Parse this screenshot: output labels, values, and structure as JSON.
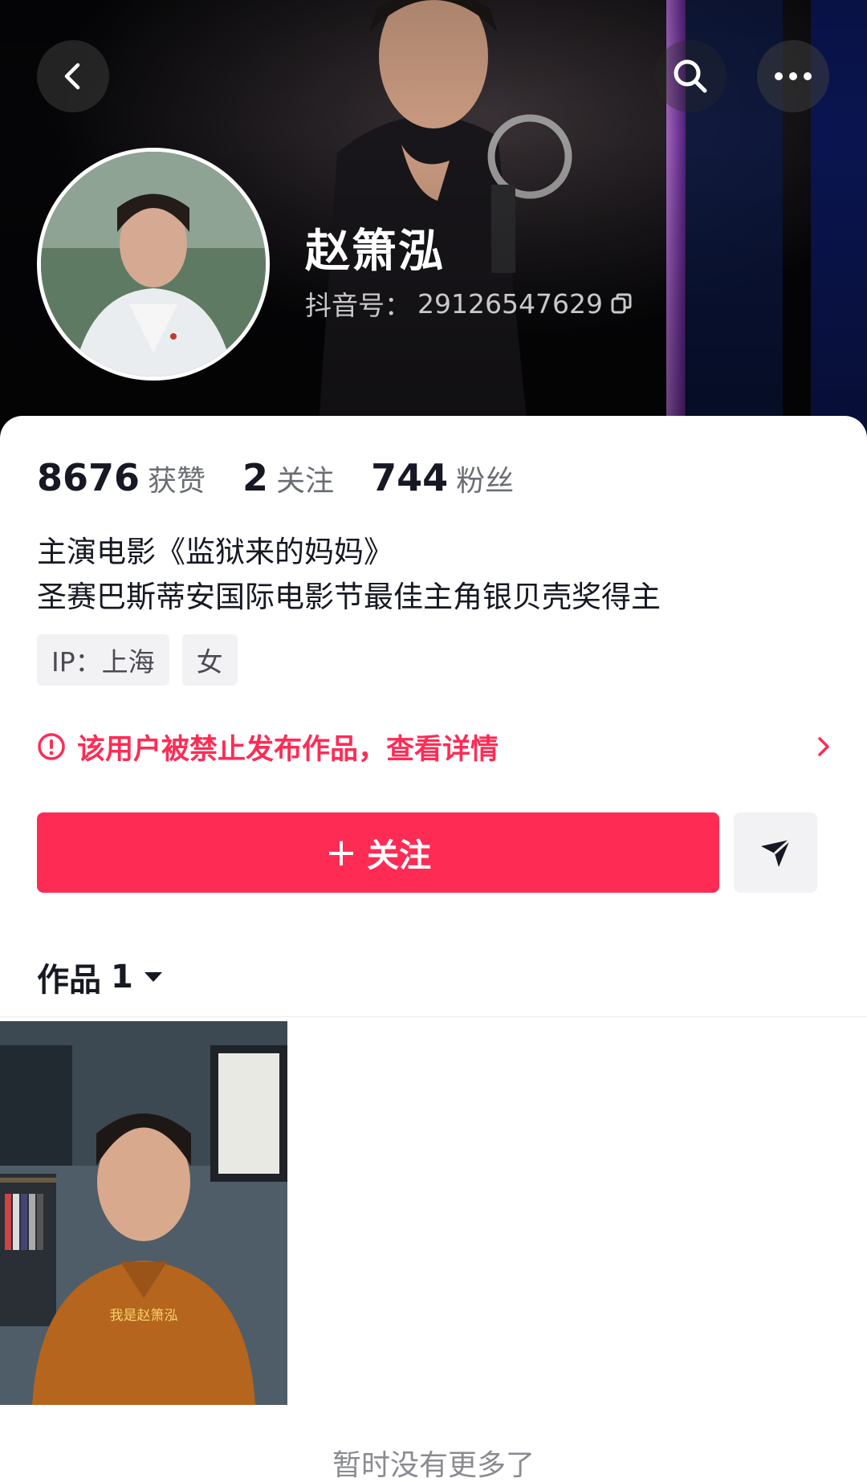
{
  "profile": {
    "name": "赵箫泓",
    "uid_label": "抖音号：",
    "uid_value": "29126547629"
  },
  "stats": [
    {
      "value": "8676",
      "label": "获赞"
    },
    {
      "value": "2",
      "label": "关注"
    },
    {
      "value": "744",
      "label": "粉丝"
    }
  ],
  "bio": {
    "line1": "主演电影《监狱来的妈妈》",
    "line2": "圣赛巴斯蒂安国际电影节最佳主角银贝壳奖得主"
  },
  "tags": [
    "IP：上海",
    "女"
  ],
  "notice": {
    "text": "该用户被禁止发布作品，查看详情"
  },
  "actions": {
    "follow_plus": "+",
    "follow_label": "关注"
  },
  "works": {
    "tab_label": "作品",
    "count": "1"
  },
  "thumbnail": {
    "caption": "我是赵箫泓"
  },
  "footer": {
    "no_more": "暂时没有更多了"
  },
  "icons": {
    "back": "chevron-left-icon",
    "search": "search-icon",
    "more": "more-icon",
    "copy": "copy-icon",
    "warning": "warning-circle-icon",
    "chevron": "chevron-right-icon",
    "share": "send-icon",
    "caret": "caret-down-icon"
  },
  "colors": {
    "accent": "#fe2c55",
    "text": "#161823",
    "muted": "#6b6d75"
  }
}
